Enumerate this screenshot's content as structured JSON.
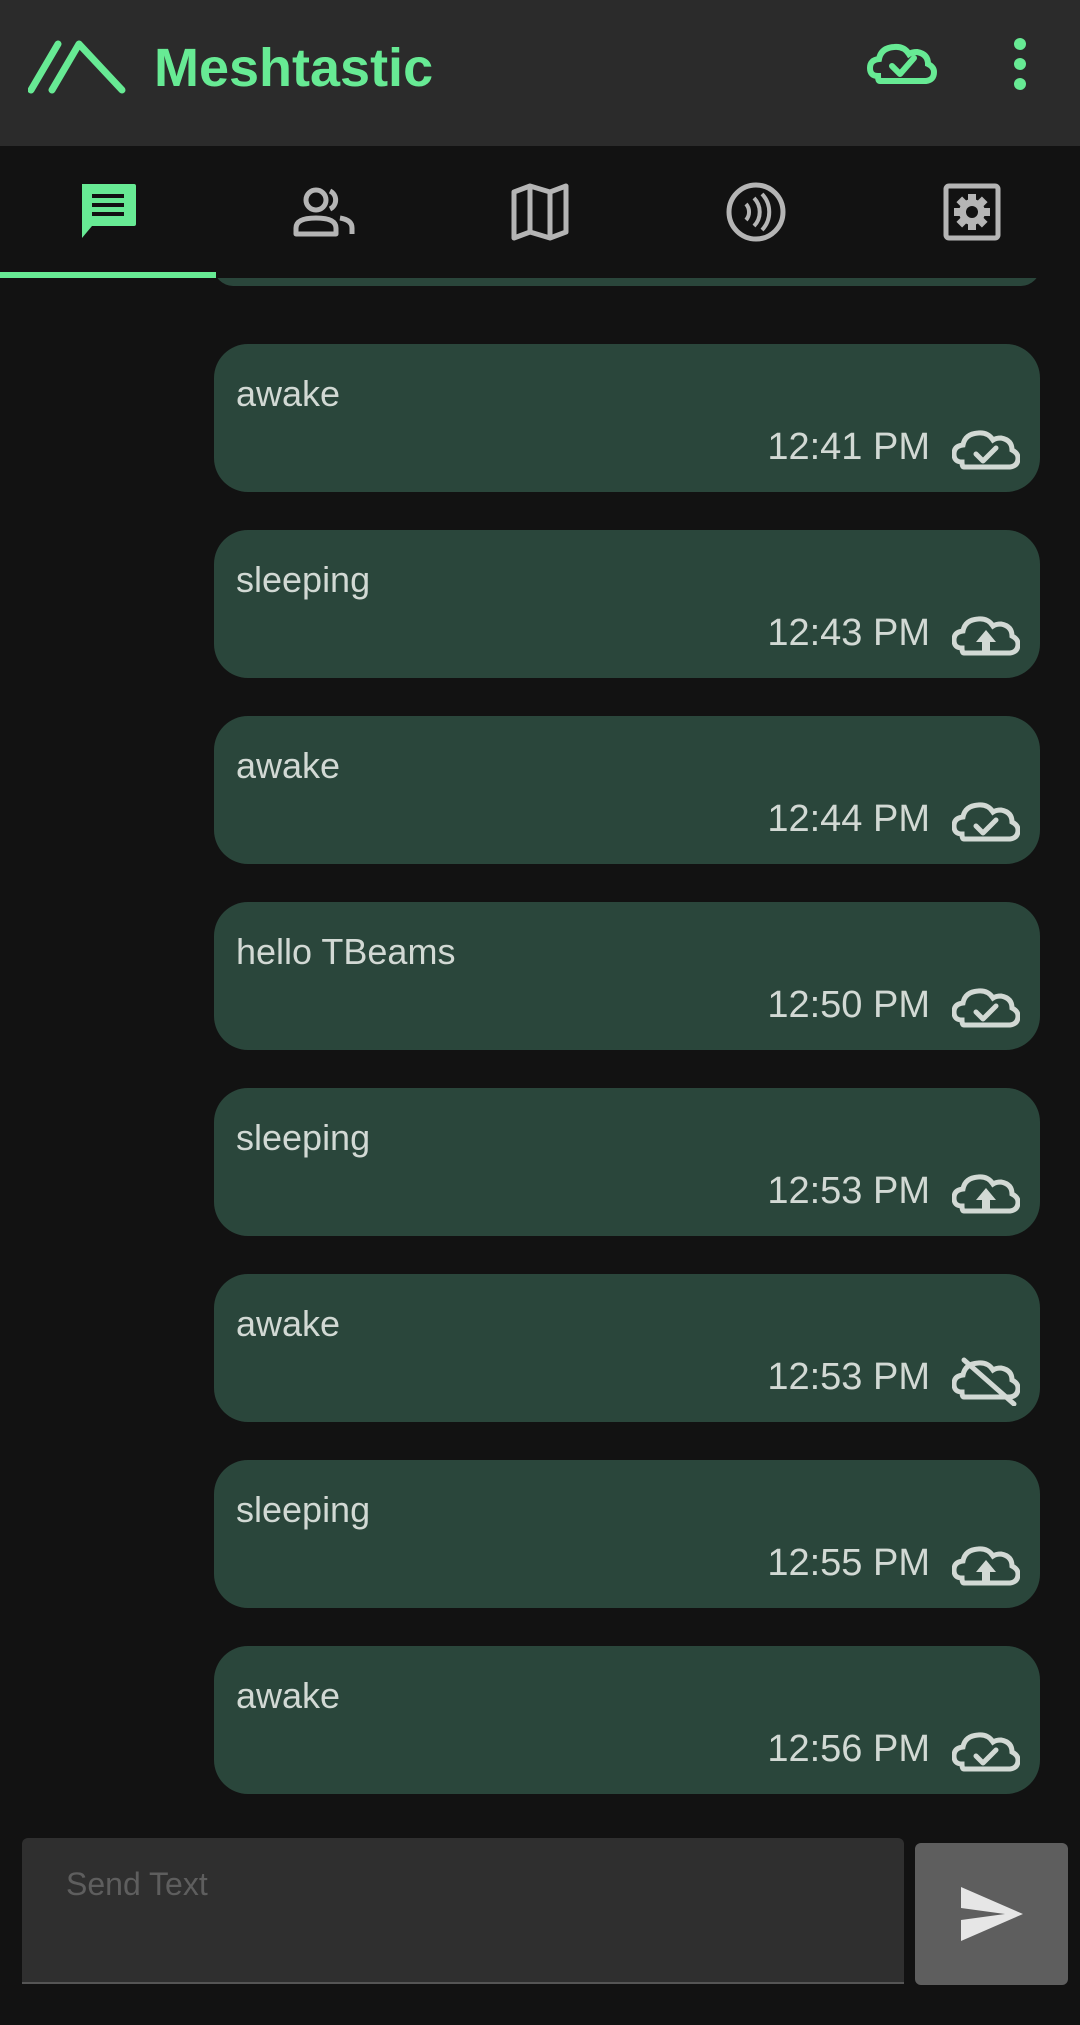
{
  "app": {
    "title": "Meshtastic"
  },
  "colors": {
    "accent": "#67ea94",
    "appbar_bg": "#2b2b2b",
    "background": "#121212",
    "bubble_bg": "#2a463b",
    "bubble_text": "#d2d9d4",
    "icon_inactive": "#b5b5b5"
  },
  "appbar": {
    "logo_icon": "meshtastic-logo-icon",
    "status_icon": "cloud-done-icon",
    "menu_icon": "more-vert-icon"
  },
  "tabs": [
    {
      "id": "messages",
      "icon": "chat-icon",
      "selected": true
    },
    {
      "id": "users",
      "icon": "people-icon",
      "selected": false
    },
    {
      "id": "map",
      "icon": "map-icon",
      "selected": false
    },
    {
      "id": "channel",
      "icon": "nfc-signal-icon",
      "selected": false
    },
    {
      "id": "settings",
      "icon": "settings-icon",
      "selected": false
    }
  ],
  "messages": [
    {
      "text": "awake",
      "time": "12:41 PM",
      "status": "cloud-done-icon"
    },
    {
      "text": "sleeping",
      "time": "12:43 PM",
      "status": "cloud-upload-icon"
    },
    {
      "text": "awake",
      "time": "12:44 PM",
      "status": "cloud-done-icon"
    },
    {
      "text": "hello TBeams",
      "time": "12:50 PM",
      "status": "cloud-done-icon"
    },
    {
      "text": "sleeping",
      "time": "12:53 PM",
      "status": "cloud-upload-icon"
    },
    {
      "text": "awake",
      "time": "12:53 PM",
      "status": "cloud-off-icon"
    },
    {
      "text": "sleeping",
      "time": "12:55 PM",
      "status": "cloud-upload-icon"
    },
    {
      "text": "awake",
      "time": "12:56 PM",
      "status": "cloud-done-icon"
    }
  ],
  "composer": {
    "placeholder": "Send Text",
    "value": "",
    "send_icon": "send-icon"
  }
}
